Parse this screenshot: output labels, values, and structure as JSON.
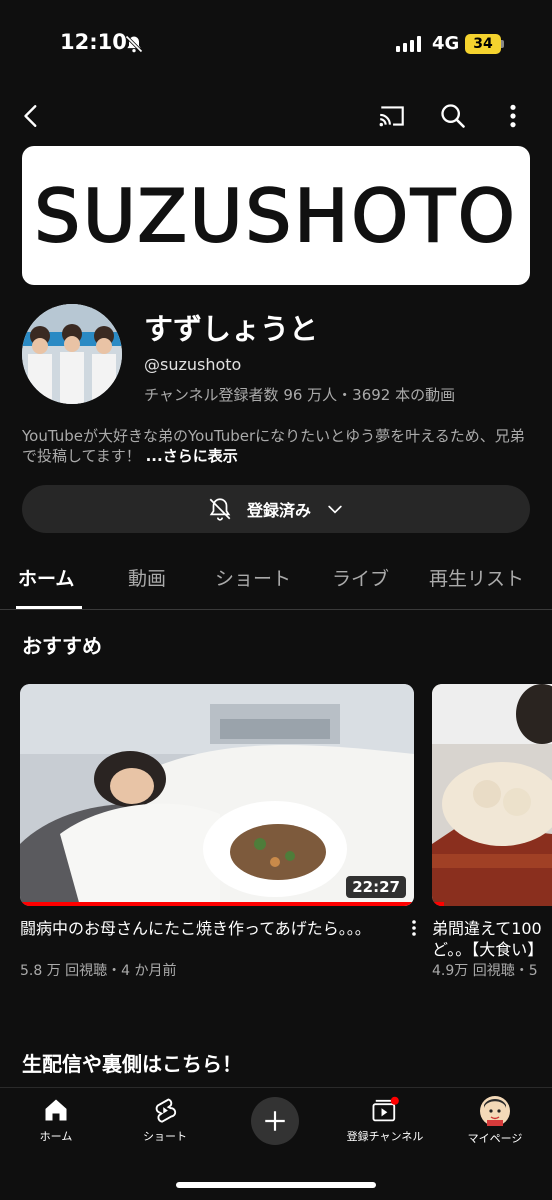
{
  "status_bar": {
    "time": "12:10",
    "network": "4G",
    "battery": "34",
    "icons": [
      "bell-off-icon",
      "signal-icon",
      "battery-icon"
    ]
  },
  "top_bar": {
    "icons": [
      "back-icon",
      "cast-icon",
      "search-icon",
      "more-vert-icon"
    ]
  },
  "channel": {
    "banner_text": "SUZUSHOTO",
    "name": "すずしょうと",
    "handle": "@suzushoto",
    "stats": "チャンネル登録者数 96 万人・3692 本の動画",
    "description": "YouTubeが大好きな弟のYouTuberになりたいとゆう夢を叶えるため、兄弟で投稿してます！",
    "description_more": "...さらに表示",
    "subscribe_label": "登録済み"
  },
  "tabs": [
    "ホーム",
    "動画",
    "ショート",
    "ライブ",
    "再生リスト"
  ],
  "active_tab": "ホーム",
  "sections": {
    "recommended": "おすすめ",
    "live": "生配信や裏側はこちら！"
  },
  "videos": [
    {
      "title": "闘病中のお母さんにたこ焼き作ってあげたら。。。",
      "meta": "5.8 万 回視聴・4 か月前",
      "duration": "22:27",
      "progress": 1.0
    },
    {
      "title": "弟間違えて100",
      "title_line2": "ど。。【大食い】",
      "meta": "4.9万 回視聴・5",
      "progress": 0.1
    }
  ],
  "bottom_nav": [
    {
      "label": "ホーム",
      "icon": "home-icon"
    },
    {
      "label": "ショート",
      "icon": "shorts-icon"
    },
    {
      "label": "",
      "icon": "create-icon"
    },
    {
      "label": "登録チャンネル",
      "icon": "subscriptions-icon"
    },
    {
      "label": "マイページ",
      "icon": "avatar-icon"
    }
  ],
  "colors": {
    "background": "#0f0f0f",
    "accent": "#ff0000",
    "battery": "#f5d32e"
  }
}
